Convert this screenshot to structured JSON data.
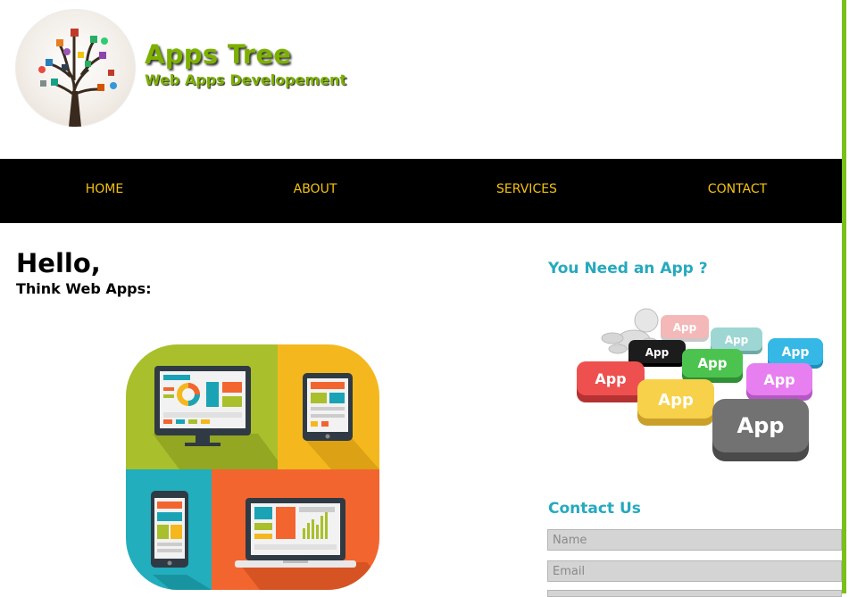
{
  "brand": {
    "title": "Apps Tree",
    "subtitle": "Web Apps Developement"
  },
  "nav": {
    "items": [
      {
        "label": "HOME"
      },
      {
        "label": "ABOUT"
      },
      {
        "label": "SERVICES"
      },
      {
        "label": "CONTACT"
      }
    ]
  },
  "main": {
    "greeting": "Hello,",
    "tagline": "Think Web Apps:"
  },
  "sidebar": {
    "app_heading": "You Need an App ?",
    "app_key_label": "App",
    "contact_heading": "Contact Us",
    "name_placeholder": "Name",
    "email_placeholder": "Email"
  },
  "colors": {
    "accent_green": "#7db100",
    "nav_background": "#000000",
    "nav_text": "#f4c20d",
    "heading_teal": "#26a9bf"
  }
}
